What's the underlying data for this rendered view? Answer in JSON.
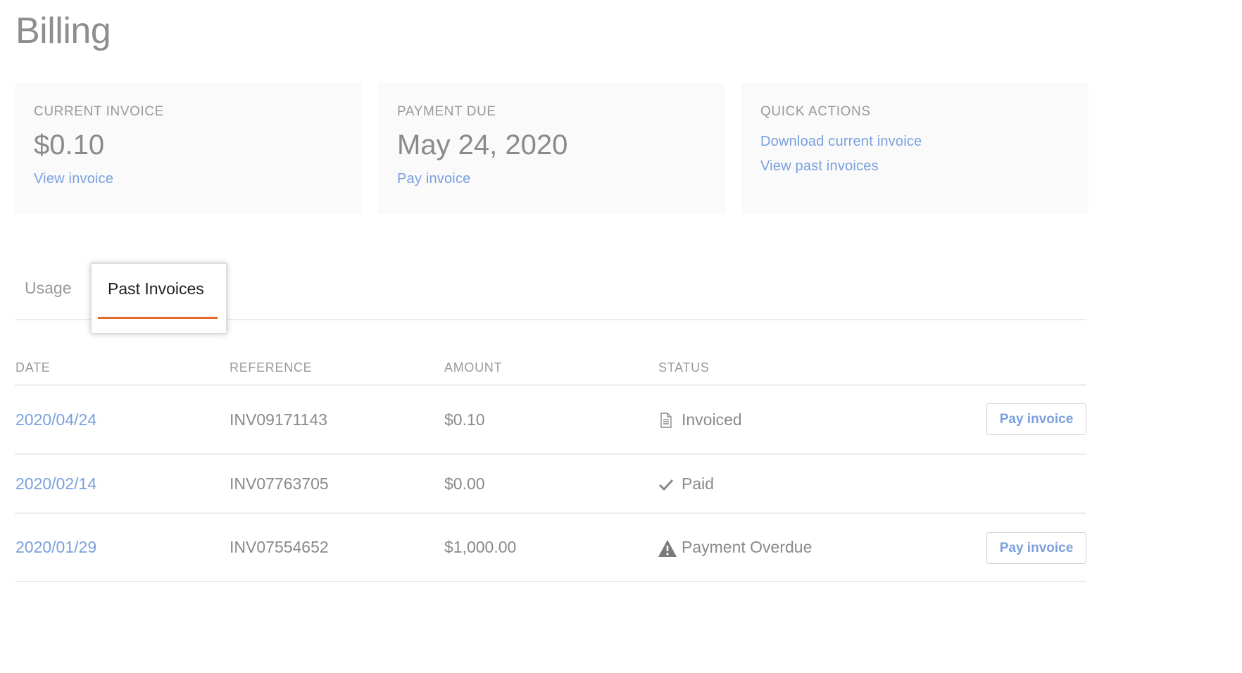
{
  "page": {
    "title": "Billing"
  },
  "cards": {
    "current_invoice": {
      "label": "CURRENT INVOICE",
      "value": "$0.10",
      "link": "View invoice"
    },
    "payment_due": {
      "label": "PAYMENT DUE",
      "value": "May 24, 2020",
      "link": "Pay invoice"
    },
    "quick_actions": {
      "label": "QUICK ACTIONS",
      "links": [
        "Download current invoice",
        "View past invoices"
      ]
    }
  },
  "tabs": [
    {
      "label": "Usage",
      "active": false
    },
    {
      "label": "Past Invoices",
      "active": true
    }
  ],
  "colors": {
    "accent_link": "#7aa0de",
    "active_tab_underline": "#e26a28"
  },
  "table": {
    "headers": [
      "DATE",
      "REFERENCE",
      "AMOUNT",
      "STATUS"
    ],
    "rows": [
      {
        "date": "2020/04/24",
        "reference": "INV09171143",
        "amount": "$0.10",
        "status": "Invoiced",
        "status_icon": "document-icon",
        "action": "Pay invoice"
      },
      {
        "date": "2020/02/14",
        "reference": "INV07763705",
        "amount": "$0.00",
        "status": "Paid",
        "status_icon": "checkmark-icon",
        "action": null
      },
      {
        "date": "2020/01/29",
        "reference": "INV07554652",
        "amount": "$1,000.00",
        "status": "Payment Overdue",
        "status_icon": "warning-icon",
        "action": "Pay invoice"
      }
    ]
  }
}
